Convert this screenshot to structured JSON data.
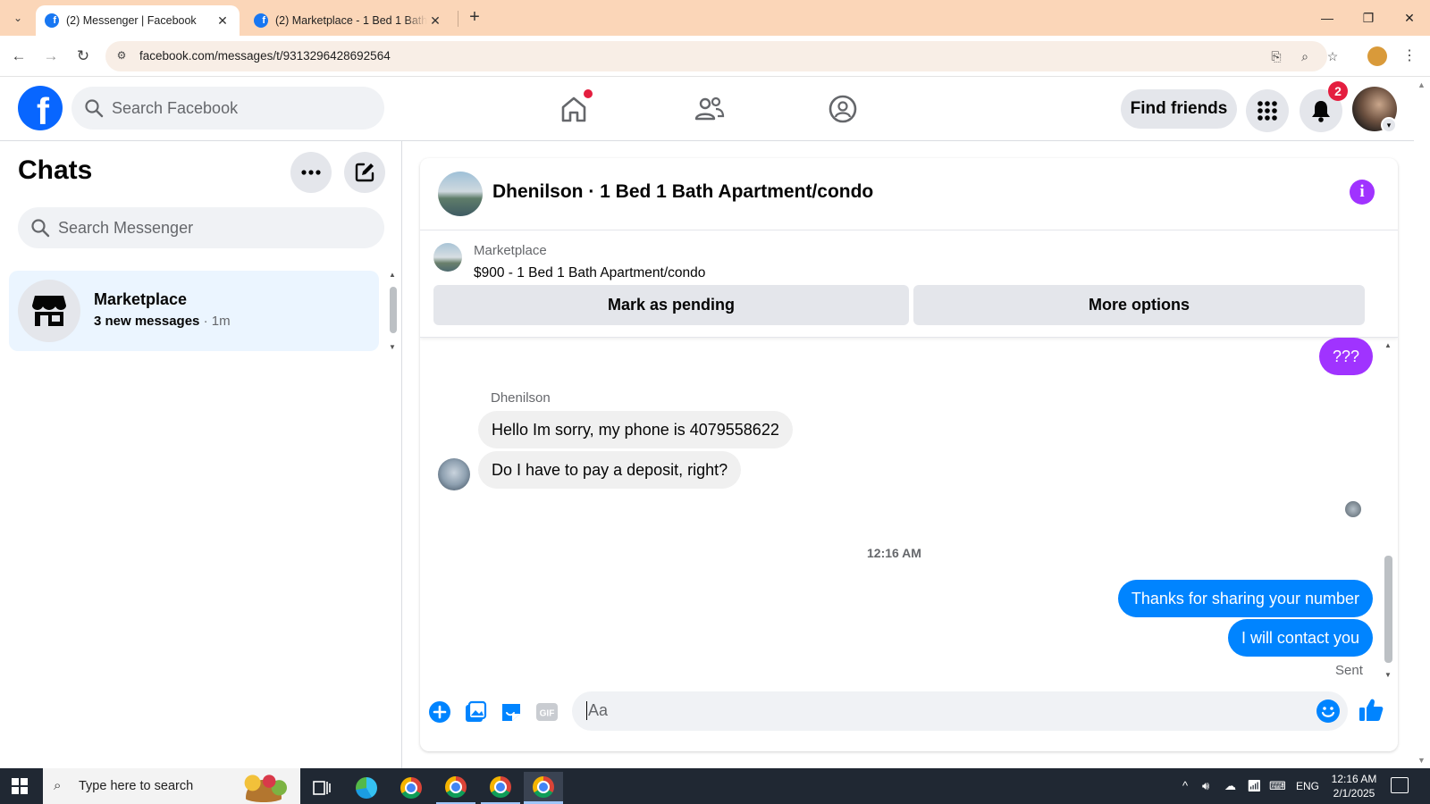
{
  "browser": {
    "tabs": [
      {
        "title": "(2) Messenger | Facebook",
        "active": true
      },
      {
        "title": "(2) Marketplace - 1 Bed 1 Bath Apartment/condo",
        "active": false
      }
    ],
    "url": "facebook.com/messages/t/9313296428692564"
  },
  "fb_header": {
    "search_placeholder": "Search Facebook",
    "find_friends_label": "Find friends",
    "notification_count": "2",
    "logo": "f"
  },
  "sidebar": {
    "title": "Chats",
    "search_placeholder": "Search Messenger",
    "chats": [
      {
        "name": "Marketplace",
        "summary": "3 new messages",
        "time": " · 1m"
      }
    ]
  },
  "conversation": {
    "title": "Dhenilson · 1 Bed 1 Bath Apartment/condo",
    "info_glyph": "i",
    "listing": {
      "category": "Marketplace",
      "title": "$900 - 1 Bed 1 Bath Apartment/condo",
      "mark_pending_label": "Mark as pending",
      "more_options_label": "More options"
    },
    "messages": {
      "first_outgoing": "???",
      "sender_name": "Dhenilson",
      "incoming": [
        "Hello Im sorry, my phone is 4079558622",
        "Do I have to pay a deposit, right?"
      ],
      "timestamp": "12:16 AM",
      "outgoing": [
        "Thanks for sharing your number",
        "I will contact you"
      ],
      "status": "Sent"
    },
    "composer_placeholder": "Aa",
    "gif_label": "GIF"
  },
  "taskbar": {
    "search_placeholder": "Type here to search",
    "language": "ENG",
    "time": "12:16 AM",
    "date": "2/1/2025"
  },
  "colors": {
    "fb_blue": "#0866ff",
    "outgoing_bubble": "#0084ff",
    "accent_purple": "#a033ff",
    "tab_strip": "#fbd6b8"
  }
}
